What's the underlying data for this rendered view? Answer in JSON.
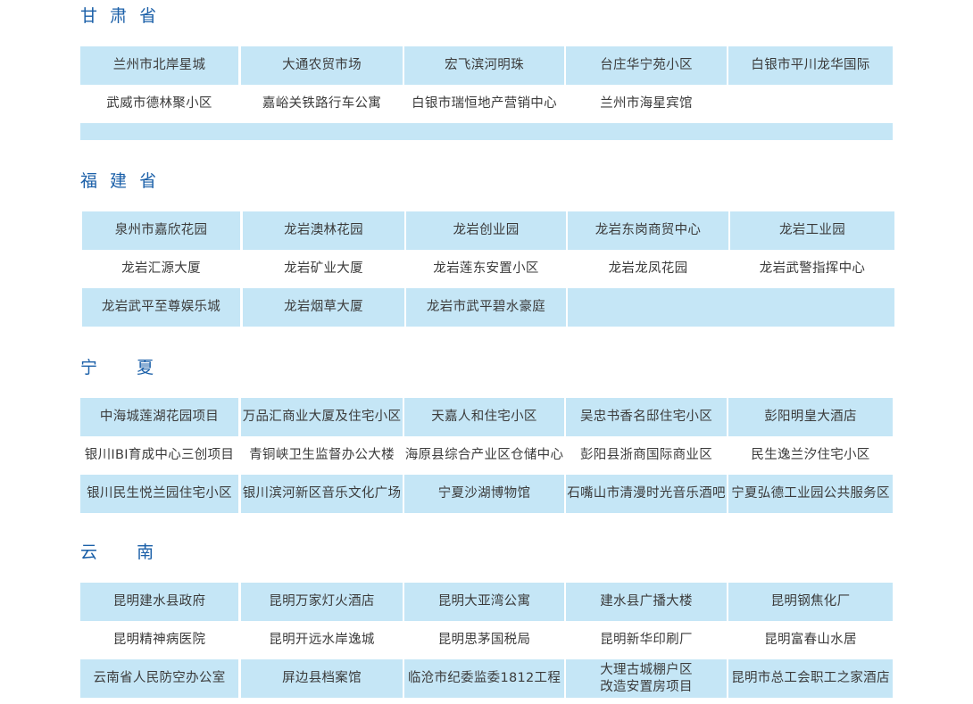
{
  "sections": [
    {
      "title": "甘 肃 省",
      "rows": [
        [
          "兰州市北岸星城",
          "大通农贸市场",
          "宏飞滨河明珠",
          "台庄华宁苑小区",
          "白银市平川龙华国际"
        ],
        [
          "武威市德林聚小区",
          "嘉峪关铁路行车公寓",
          "白银市瑞恒地产营销中心",
          "兰州市海星宾馆",
          ""
        ]
      ]
    },
    {
      "title": "福 建 省",
      "rows": [
        [
          "泉州市嘉欣花园",
          "龙岩澳林花园",
          "龙岩创业园",
          "龙岩东岗商贸中心",
          "龙岩工业园"
        ],
        [
          "龙岩汇源大厦",
          "龙岩矿业大厦",
          "龙岩莲东安置小区",
          "龙岩龙凤花园",
          "龙岩武警指挥中心"
        ],
        [
          "龙岩武平至尊娱乐城",
          "龙岩烟草大厦",
          "龙岩市武平碧水豪庭",
          "",
          ""
        ]
      ]
    },
    {
      "title": "宁    夏",
      "rows": [
        [
          "中海城莲湖花园项目",
          "万品汇商业大厦及住宅小区",
          "天嘉人和住宅小区",
          "吴忠书香名邸住宅小区",
          "彭阳明皇大酒店"
        ],
        [
          "银川IBI育成中心三创项目",
          "青铜峡卫生监督办公大楼",
          "海原县综合产业区仓储中心",
          "彭阳县浙商国际商业区",
          "民生逸兰汐住宅小区"
        ],
        [
          "银川民生悦兰园住宅小区",
          "银川滨河新区音乐文化广场",
          "宁夏沙湖博物馆",
          "石嘴山市清漫时光音乐酒吧",
          "宁夏弘德工业园公共服务区"
        ]
      ]
    },
    {
      "title": "云    南",
      "rows": [
        [
          "昆明建水县政府",
          "昆明万家灯火酒店",
          "昆明大亚湾公寓",
          "建水县广播大楼",
          "昆明钢焦化厂"
        ],
        [
          "昆明精神病医院",
          "昆明开远水岸逸城",
          "昆明思茅国税局",
          "昆明新华印刷厂",
          "昆明富春山水居"
        ],
        [
          "云南省人民防空办公室",
          "屏边县档案馆",
          "临沧市纪委监委1812工程",
          "大理古城棚户区\n改造安置房项目",
          "昆明市总工会职工之家酒店"
        ]
      ]
    }
  ]
}
